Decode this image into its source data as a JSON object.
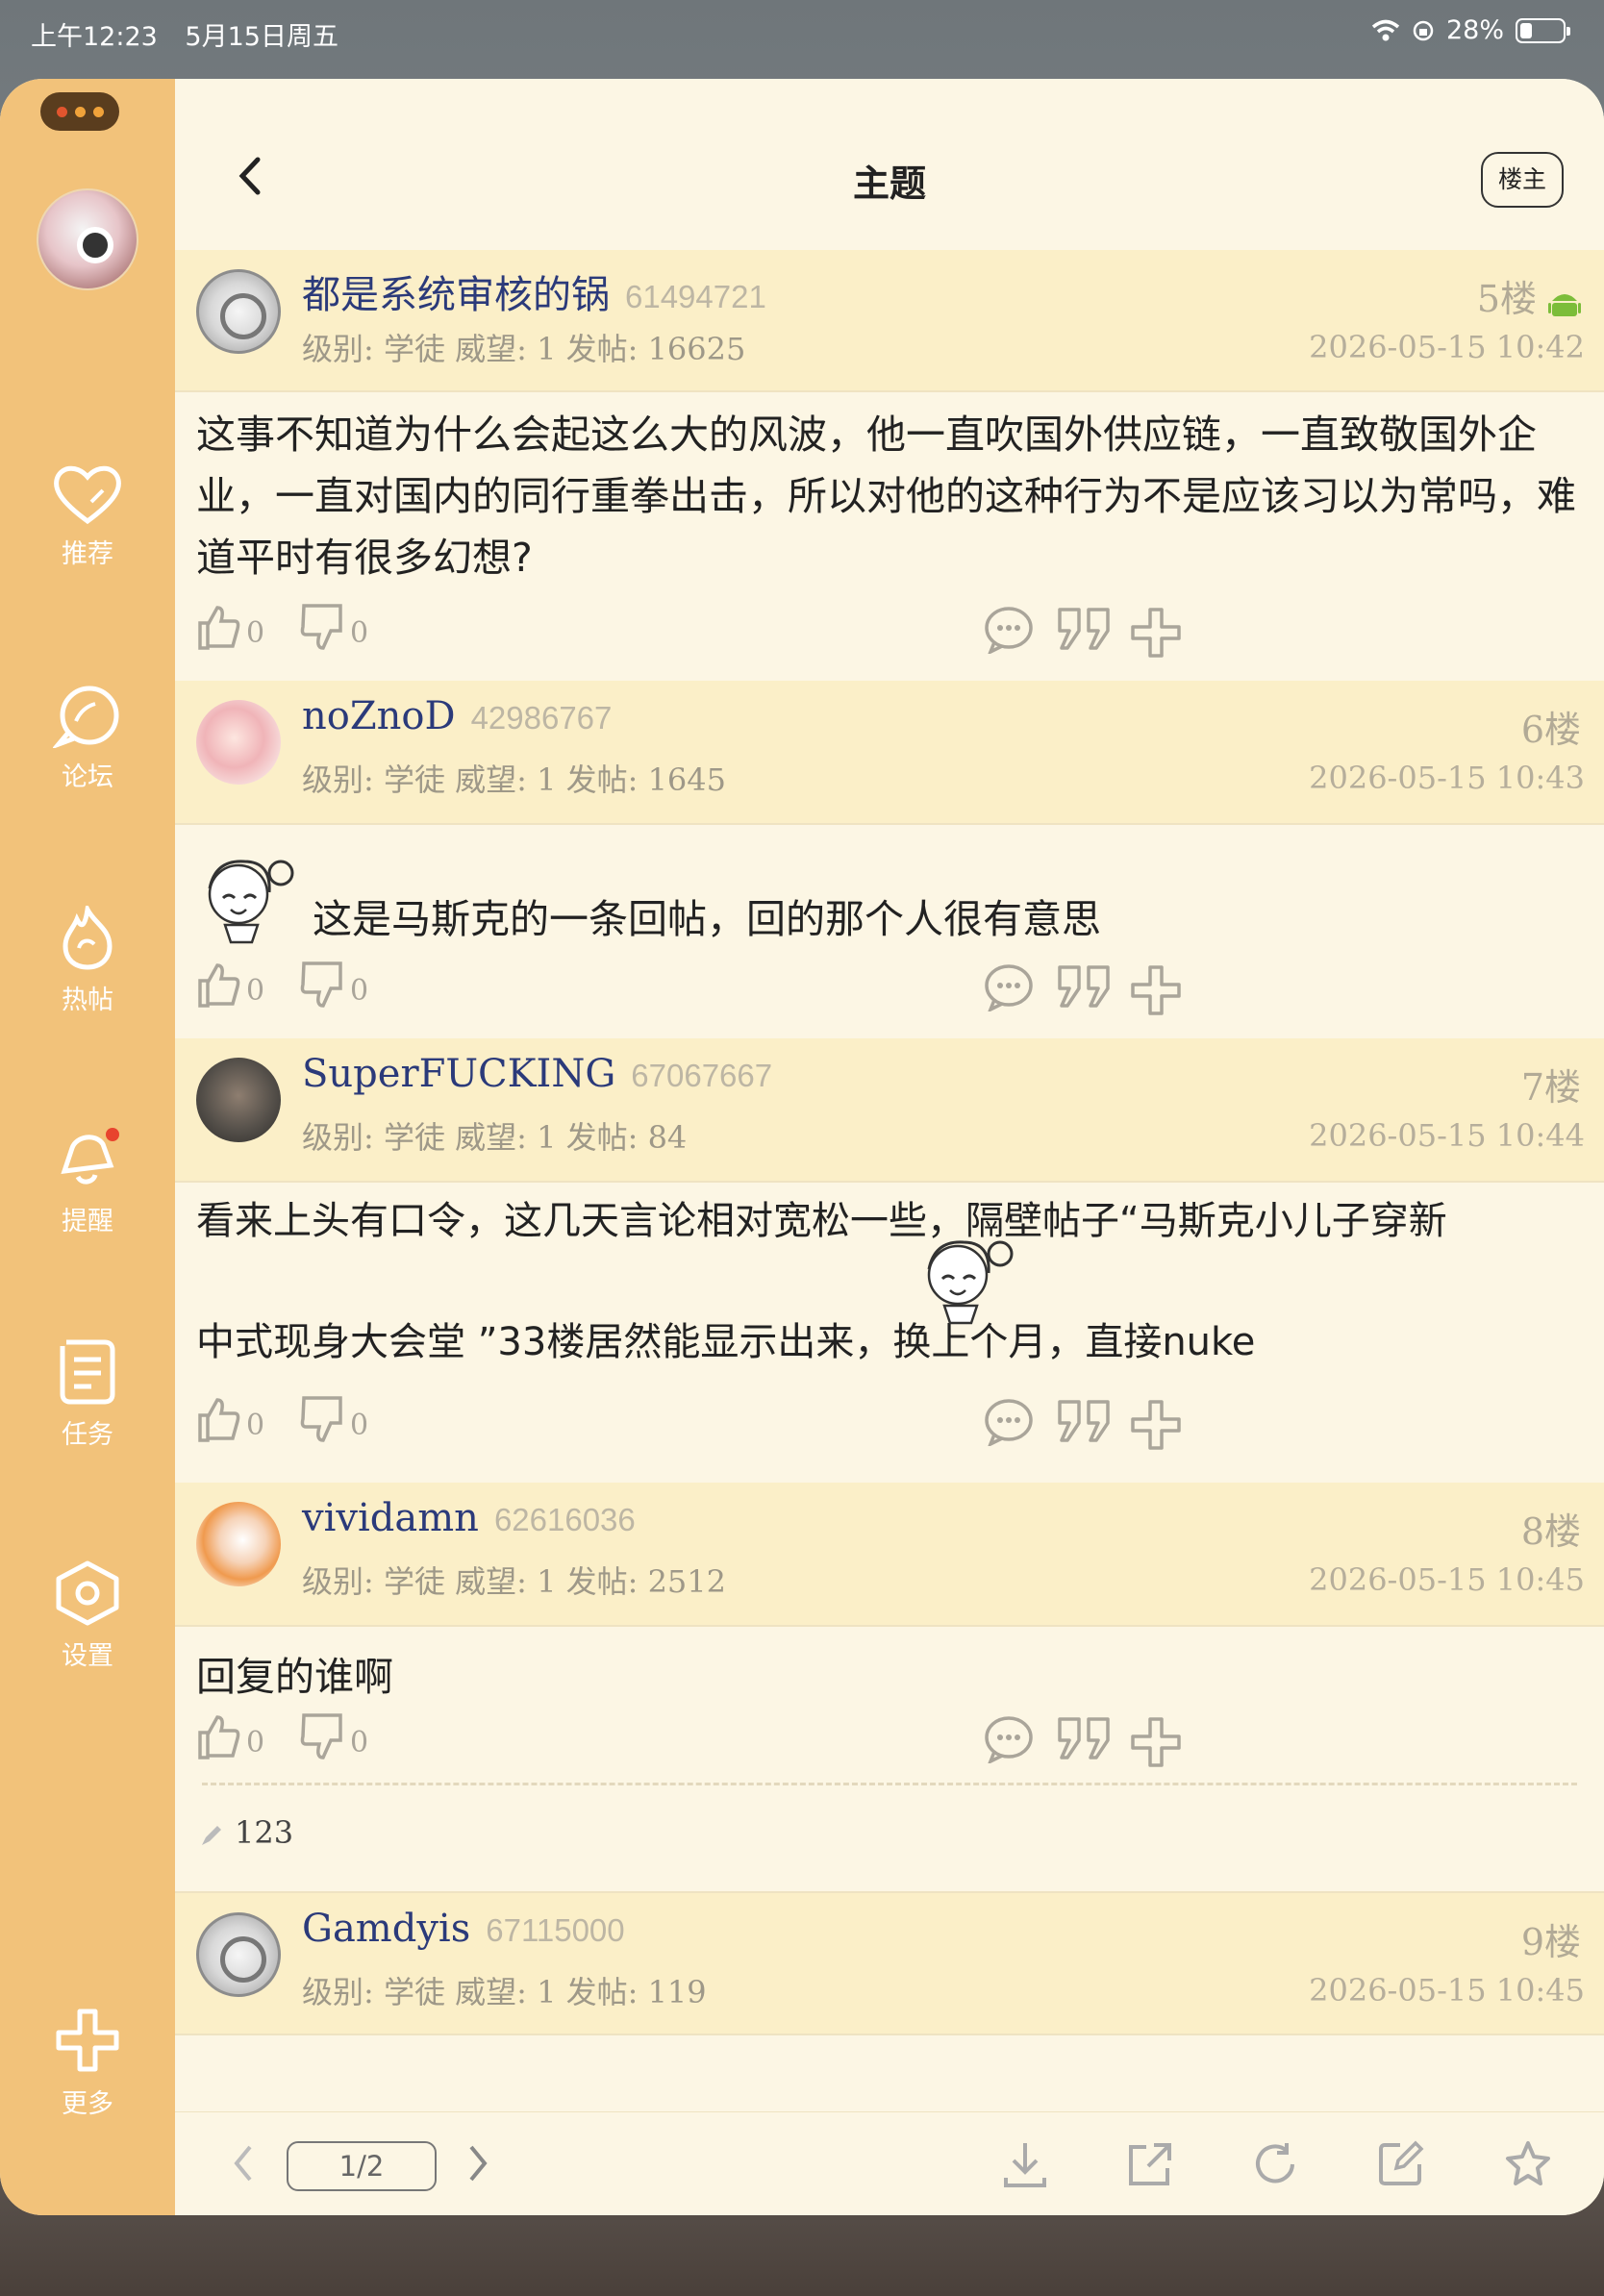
{
  "status_bar": {
    "time": "上午12:23",
    "date": "5月15日周五",
    "battery": "28%"
  },
  "sidebar": {
    "items": [
      {
        "label": "推荐"
      },
      {
        "label": "论坛"
      },
      {
        "label": "热帖"
      },
      {
        "label": "提醒"
      },
      {
        "label": "任务"
      },
      {
        "label": "设置"
      },
      {
        "label": "更多"
      }
    ]
  },
  "header": {
    "title": "主题",
    "op_button": "楼主"
  },
  "posts": [
    {
      "username": "都是系统审核的锅",
      "uid": "61494721",
      "meta": "级别: 学徒  威望: 1  发帖: 16625",
      "floor": "5楼",
      "time": "2026-05-15 10:42",
      "body": "这事不知道为什么会起这么大的风波，他一直吹国外供应链，一直致敬国外企业，一直对国内的同行重拳出击，所以对他的这种行为不是应该习以为常吗，难道平时有很多幻想?",
      "likes": "0",
      "dislikes": "0"
    },
    {
      "username": "noZnoD",
      "uid": "42986767",
      "meta": "级别: 学徒  威望: 1  发帖: 1645",
      "floor": "6楼",
      "time": "2026-05-15 10:43",
      "body": "这是马斯克的一条回帖，回的那个人很有意思",
      "likes": "0",
      "dislikes": "0"
    },
    {
      "username": "SuperFUCKING",
      "uid": "67067667",
      "meta": "级别: 学徒  威望: 1  发帖: 84",
      "floor": "7楼",
      "time": "2026-05-15 10:44",
      "body_line1": "看来上头有口令，这几天言论相对宽松一些，隔壁帖子“马斯克小儿子穿新",
      "body_line2": "中式现身大会堂 ”33楼居然能显示出来，换上个月，直接nuke",
      "likes": "0",
      "dislikes": "0"
    },
    {
      "username": "vividamn",
      "uid": "62616036",
      "meta": "级别: 学徒  威望: 1  发帖: 2512",
      "floor": "8楼",
      "time": "2026-05-15 10:45",
      "body": "回复的谁啊",
      "likes": "0",
      "dislikes": "0",
      "edit_note": "123"
    },
    {
      "username": "Gamdyis",
      "uid": "67115000",
      "meta": "级别: 学徒  威望: 1  发帖: 119",
      "floor": "9楼",
      "time": "2026-05-15 10:45"
    }
  ],
  "bottom_bar": {
    "page": "1/2"
  },
  "colors": {
    "sidebar": "#f2c27a",
    "post_header": "#fbefc8",
    "background": "#fcf6e4",
    "username": "#2b3a7a"
  }
}
